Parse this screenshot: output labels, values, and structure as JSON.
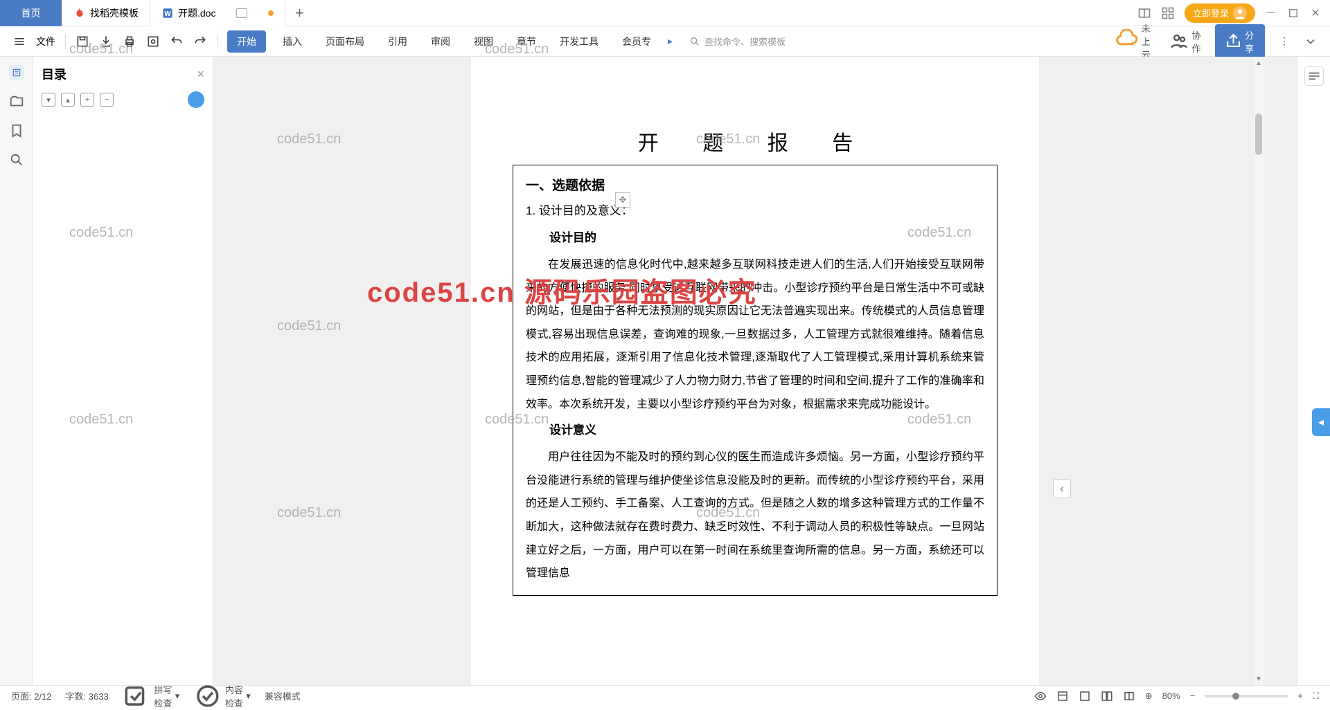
{
  "tabs": {
    "home": "首页",
    "t1": "找稻壳模板",
    "t2": "开题.doc"
  },
  "titlebar": {
    "login": "立即登录"
  },
  "toolbar": {
    "file": "文件",
    "menus": [
      "开始",
      "插入",
      "页面布局",
      "引用",
      "审阅",
      "视图",
      "章节",
      "开发工具",
      "会员专"
    ],
    "search_ph": "查找命令、搜索模板",
    "not_cloud": "未上云",
    "collab": "协作",
    "share": "分享"
  },
  "sidebar": {
    "title": "目录"
  },
  "doc": {
    "title": "开 题 报 告",
    "h1": "一、选题依据",
    "h2": "1. 设计目的及意义：",
    "h3a": "设计目的",
    "p1": "在发展迅速的信息化时代中,越来越多互联网科技走进人们的生活,人们开始接受互联网带来的方便快捷的服务,同时享受这互联网带来的冲击。小型诊疗预约平台是日常生活中不可或缺的网站，但是由于各种无法预测的现实原因让它无法普遍实现出来。传统模式的人员信息管理模式,容易出现信息误差，查询难的现象,一旦数据过多，人工管理方式就很难维持。随着信息技术的应用拓展，逐渐引用了信息化技术管理,逐渐取代了人工管理模式,采用计算机系统来管理预约信息,智能的管理减少了人力物力财力,节省了管理的时间和空间,提升了工作的准确率和效率。本次系统开发，主要以小型诊疗预约平台为对象，根据需求来完成功能设计。",
    "h3b": "设计意义",
    "p2": "用户往往因为不能及时的预约到心仪的医生而造成许多烦恼。另一方面，小型诊疗预约平台没能进行系统的管理与维护使坐诊信息没能及时的更新。而传统的小型诊疗预约平台，采用的还是人工预约、手工备案、人工查询的方式。但是随之人数的增多这种管理方式的工作量不断加大，这种做法就存在费时费力、缺乏时效性、不利于调动人员的积极性等缺点。一旦网站建立好之后，一方面，用户可以在第一时间在系统里查询所需的信息。另一方面，系统还可以管理信息"
  },
  "status": {
    "page": "页面: 2/12",
    "words": "字数: 3633",
    "spell": "拼写检查",
    "content": "内容检查",
    "compat": "兼容模式",
    "zoom": "80%"
  },
  "wm": "code51.cn",
  "big_wm": "code51.cn 源码乐园盗图必究"
}
